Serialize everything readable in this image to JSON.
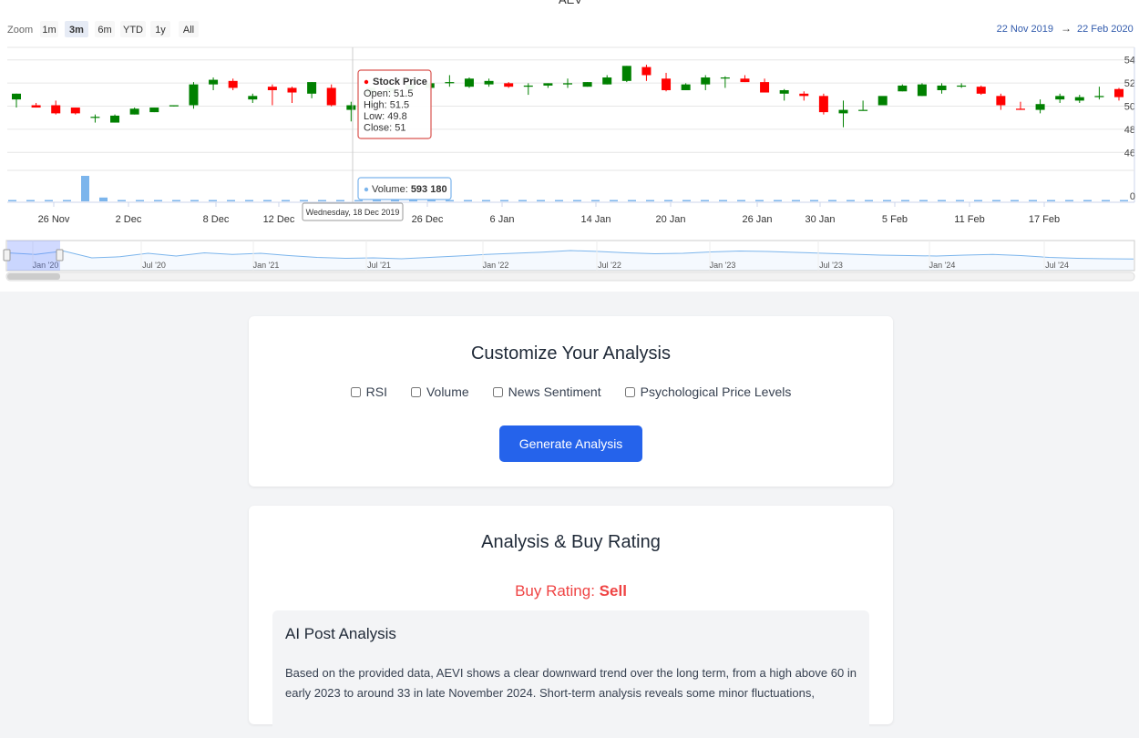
{
  "chart": {
    "title": "AEV",
    "zoom_label": "Zoom",
    "zoom_buttons": [
      "1m",
      "3m",
      "6m",
      "YTD",
      "1y",
      "All"
    ],
    "zoom_selected": "3m",
    "range_from": "22 Nov 2019",
    "range_arrow": "→",
    "range_to": "22 Feb 2020",
    "price_axis": [
      "54",
      "52",
      "50",
      "48",
      "46"
    ],
    "volume_axis": [
      "0"
    ],
    "x_axis": [
      "26 Nov",
      "2 Dec",
      "8 Dec",
      "12 Dec",
      "26 Dec",
      "6 Jan",
      "14 Jan",
      "20 Jan",
      "26 Jan",
      "30 Jan",
      "5 Feb",
      "11 Feb",
      "17 Feb"
    ],
    "navigator_axis": [
      "Jan '20",
      "Jul '20",
      "Jan '21",
      "Jul '21",
      "Jan '22",
      "Jul '22",
      "Jan '23",
      "Jul '23",
      "Jan '24",
      "Jul '24"
    ],
    "colors": {
      "up": "#008000",
      "down": "#ff0000",
      "volume": "#7cb5ec",
      "navigator": "#7cb5ec",
      "tooltip_border": "#d9534f"
    },
    "tooltip": {
      "series": "Stock Price",
      "open": "Open: 51.5",
      "high": "High: 51.5",
      "low": "Low: 49.8",
      "close": "Close: 51"
    },
    "volume_tooltip": {
      "label": "Volume: ",
      "value": "593 180"
    },
    "date_label": "Wednesday, 18 Dec 2019"
  },
  "chart_data": {
    "type": "candlestick",
    "title": "AEV",
    "ylim": [
      45,
      55
    ],
    "candles": [
      {
        "o": 50.5,
        "h": 51.0,
        "l": 49.8,
        "c": 51.0
      },
      {
        "o": 50.0,
        "h": 50.2,
        "l": 49.8,
        "c": 49.8
      },
      {
        "o": 50.0,
        "h": 50.4,
        "l": 49.2,
        "c": 49.3
      },
      {
        "o": 49.8,
        "h": 49.8,
        "l": 49.2,
        "c": 49.3
      },
      {
        "o": 49.0,
        "h": 49.2,
        "l": 48.5,
        "c": 49.0
      },
      {
        "o": 48.5,
        "h": 49.2,
        "l": 48.5,
        "c": 49.1
      },
      {
        "o": 49.2,
        "h": 49.8,
        "l": 49.2,
        "c": 49.7
      },
      {
        "o": 49.4,
        "h": 49.8,
        "l": 49.4,
        "c": 49.8
      },
      {
        "o": 49.9,
        "h": 50.0,
        "l": 49.9,
        "c": 50.0
      },
      {
        "o": 50.0,
        "h": 52.0,
        "l": 49.7,
        "c": 51.8
      },
      {
        "o": 51.8,
        "h": 52.4,
        "l": 51.3,
        "c": 52.2
      },
      {
        "o": 52.1,
        "h": 52.3,
        "l": 51.3,
        "c": 51.5
      },
      {
        "o": 50.5,
        "h": 51.0,
        "l": 50.2,
        "c": 50.8
      },
      {
        "o": 51.6,
        "h": 51.8,
        "l": 50.0,
        "c": 51.3
      },
      {
        "o": 51.5,
        "h": 51.6,
        "l": 50.2,
        "c": 51.1
      },
      {
        "o": 51.0,
        "h": 52.0,
        "l": 50.6,
        "c": 52.0
      },
      {
        "o": 51.5,
        "h": 51.8,
        "l": 49.9,
        "c": 50.0
      },
      {
        "o": 49.6,
        "h": 50.3,
        "l": 48.6,
        "c": 50.0
      },
      {
        "o": 51.0,
        "h": 51.5,
        "l": 49.8,
        "c": 51.5
      },
      {
        "o": 51.2,
        "h": 51.6,
        "l": 50.8,
        "c": 51.5
      },
      {
        "o": 51.4,
        "h": 51.8,
        "l": 51.0,
        "c": 51.8
      },
      {
        "o": 51.5,
        "h": 52.0,
        "l": 51.3,
        "c": 51.9
      },
      {
        "o": 51.9,
        "h": 52.6,
        "l": 51.6,
        "c": 52.0
      },
      {
        "o": 51.6,
        "h": 52.4,
        "l": 51.5,
        "c": 52.3
      },
      {
        "o": 51.8,
        "h": 52.3,
        "l": 51.6,
        "c": 52.1
      },
      {
        "o": 51.9,
        "h": 52.0,
        "l": 51.5,
        "c": 51.6
      },
      {
        "o": 51.6,
        "h": 51.9,
        "l": 50.9,
        "c": 51.7
      },
      {
        "o": 51.7,
        "h": 51.9,
        "l": 51.5,
        "c": 51.9
      },
      {
        "o": 51.8,
        "h": 52.3,
        "l": 51.5,
        "c": 51.9
      },
      {
        "o": 51.6,
        "h": 52.0,
        "l": 51.6,
        "c": 52.0
      },
      {
        "o": 51.8,
        "h": 52.6,
        "l": 51.8,
        "c": 52.4
      },
      {
        "o": 52.1,
        "h": 53.4,
        "l": 52.0,
        "c": 53.4
      },
      {
        "o": 53.3,
        "h": 53.5,
        "l": 52.1,
        "c": 52.6
      },
      {
        "o": 52.3,
        "h": 52.8,
        "l": 51.2,
        "c": 51.3
      },
      {
        "o": 51.3,
        "h": 51.9,
        "l": 51.3,
        "c": 51.8
      },
      {
        "o": 51.8,
        "h": 52.6,
        "l": 51.3,
        "c": 52.4
      },
      {
        "o": 52.4,
        "h": 52.5,
        "l": 51.5,
        "c": 52.4
      },
      {
        "o": 52.3,
        "h": 52.6,
        "l": 52.0,
        "c": 52.0
      },
      {
        "o": 52.0,
        "h": 52.3,
        "l": 51.3,
        "c": 51.1
      },
      {
        "o": 51.0,
        "h": 51.4,
        "l": 50.4,
        "c": 51.3
      },
      {
        "o": 51.0,
        "h": 51.2,
        "l": 50.4,
        "c": 50.8
      },
      {
        "o": 50.8,
        "h": 51.0,
        "l": 49.2,
        "c": 49.4
      },
      {
        "o": 49.3,
        "h": 50.4,
        "l": 48.1,
        "c": 49.6
      },
      {
        "o": 49.6,
        "h": 50.4,
        "l": 49.6,
        "c": 49.6
      },
      {
        "o": 50.0,
        "h": 50.5,
        "l": 50.0,
        "c": 50.8
      },
      {
        "o": 51.2,
        "h": 51.8,
        "l": 51.2,
        "c": 51.7
      },
      {
        "o": 50.8,
        "h": 51.9,
        "l": 50.8,
        "c": 51.8
      },
      {
        "o": 51.3,
        "h": 51.9,
        "l": 51.0,
        "c": 51.7
      },
      {
        "o": 51.7,
        "h": 51.9,
        "l": 51.5,
        "c": 51.7
      },
      {
        "o": 51.6,
        "h": 51.7,
        "l": 50.9,
        "c": 51.0
      },
      {
        "o": 50.8,
        "h": 51.0,
        "l": 49.6,
        "c": 50.0
      },
      {
        "o": 49.7,
        "h": 50.3,
        "l": 49.6,
        "c": 49.6
      },
      {
        "o": 49.6,
        "h": 50.5,
        "l": 49.3,
        "c": 50.1
      },
      {
        "o": 50.5,
        "h": 51.0,
        "l": 50.2,
        "c": 50.8
      },
      {
        "o": 50.4,
        "h": 50.9,
        "l": 50.2,
        "c": 50.7
      },
      {
        "o": 50.7,
        "h": 51.6,
        "l": 50.5,
        "c": 50.8
      },
      {
        "o": 51.4,
        "h": 51.5,
        "l": 50.4,
        "c": 50.7
      }
    ],
    "volume": [
      0.02,
      0.02,
      0.02,
      0.02,
      1.0,
      0.15,
      0.05,
      0.03,
      0.03,
      0.02,
      0.02,
      0.02,
      0.02,
      0.02,
      0.02,
      0.03,
      0.03,
      0.04,
      0.04,
      0.03,
      0.02,
      0.02,
      0.02,
      0.03,
      0.03,
      0.02,
      0.02,
      0.02,
      0.02,
      0.03,
      0.02,
      0.02,
      0.02,
      0.02,
      0.02,
      0.02,
      0.02,
      0.02,
      0.03,
      0.02,
      0.02,
      0.02,
      0.02,
      0.02,
      0.02,
      0.02,
      0.03,
      0.02,
      0.02,
      0.02,
      0.02,
      0.02,
      0.02,
      0.03,
      0.02,
      0.02,
      0.02,
      0.02,
      0.03,
      0.02,
      0.02,
      0.02
    ],
    "navigator_series": [
      0.62,
      0.55,
      0.7,
      0.4,
      0.45,
      0.6,
      0.48,
      0.62,
      0.55,
      0.6,
      0.5,
      0.42,
      0.38,
      0.4,
      0.36,
      0.42,
      0.48,
      0.55,
      0.6,
      0.65,
      0.72,
      0.68,
      0.62,
      0.58,
      0.6,
      0.66,
      0.7,
      0.68,
      0.64,
      0.6,
      0.56,
      0.52,
      0.5,
      0.48,
      0.52,
      0.55,
      0.5,
      0.42,
      0.38,
      0.36,
      0.35
    ]
  },
  "customize": {
    "title": "Customize Your Analysis",
    "options": [
      "RSI",
      "Volume",
      "News Sentiment",
      "Psychological Price Levels"
    ],
    "button": "Generate Analysis"
  },
  "analysis": {
    "title": "Analysis & Buy Rating",
    "rating_label": "Buy Rating: ",
    "rating_value": "Sell",
    "ai_title": "AI Post Analysis",
    "ai_text": "Based on the provided data, AEVI shows a clear downward trend over the long term, from a high above 60 in early 2023 to around 33 in late November 2024. Short-term analysis reveals some minor fluctuations,"
  }
}
